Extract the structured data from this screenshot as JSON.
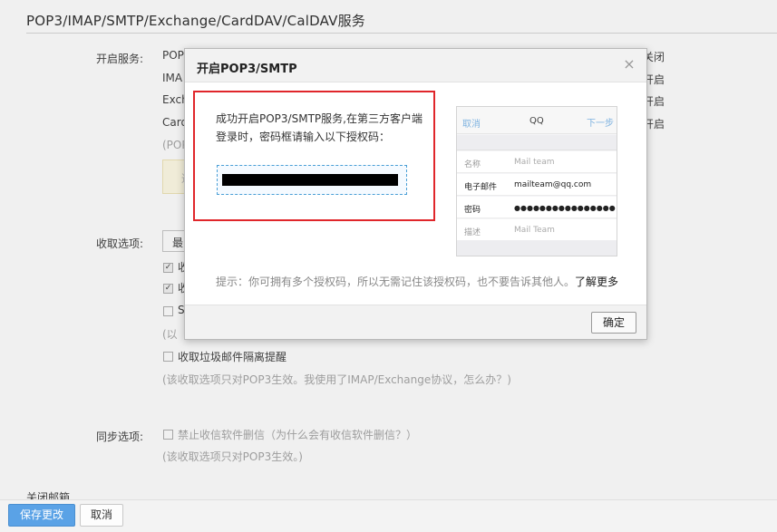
{
  "section": {
    "title": "POP3/IMAP/SMTP/Exchange/CardDAV/CalDAV服务"
  },
  "services": {
    "label": "开启服务:",
    "items": [
      {
        "name": "POP",
        "state": "关闭"
      },
      {
        "name": "IMA",
        "state": "开启"
      },
      {
        "name": "Exch",
        "state": "开启"
      },
      {
        "name": "Card",
        "state": "开启"
      }
    ],
    "note": "(POP",
    "tip_char": "通"
  },
  "fetch": {
    "label": "收取选项:",
    "select_value": "最",
    "options": [
      {
        "text": "收",
        "checked": true
      },
      {
        "text": "收",
        "checked": true
      },
      {
        "text": "S",
        "checked": false
      }
    ],
    "note1": "(以",
    "spam_option": "收取垃圾邮件隔离提醒",
    "note2": "(该收取选项只对POP3生效。我使用了IMAP/Exchange协议，怎么办？)"
  },
  "sync": {
    "label": "同步选项:",
    "option": "禁止收信软件删信（为什么会有收信软件删信？）",
    "note": "(该收取选项只对POP3生效。)"
  },
  "close_group": "关闭邮箱",
  "bottom": {
    "save": "保存更改",
    "cancel": "取消"
  },
  "dialog": {
    "title": "开启POP3/SMTP",
    "close": "×",
    "message": "成功开启POP3/SMTP服务,在第三方客户端登录时，密码框请输入以下授权码：",
    "phone": {
      "cancel": "取消",
      "title": "QQ",
      "next": "下一步",
      "rows": [
        {
          "key": "名称",
          "value": "Mail team"
        },
        {
          "key": "电子邮件",
          "value": "mailteam@qq.com"
        },
        {
          "key": "密码",
          "value": "●●●●●●●●●●●●●●●●"
        },
        {
          "key": "描述",
          "value": "Mail Team"
        }
      ]
    },
    "hint": "提示：你可拥有多个授权码，所以无需记住该授权码，也不要告诉其他人。",
    "learn_more": "了解更多",
    "ok": "确定"
  }
}
